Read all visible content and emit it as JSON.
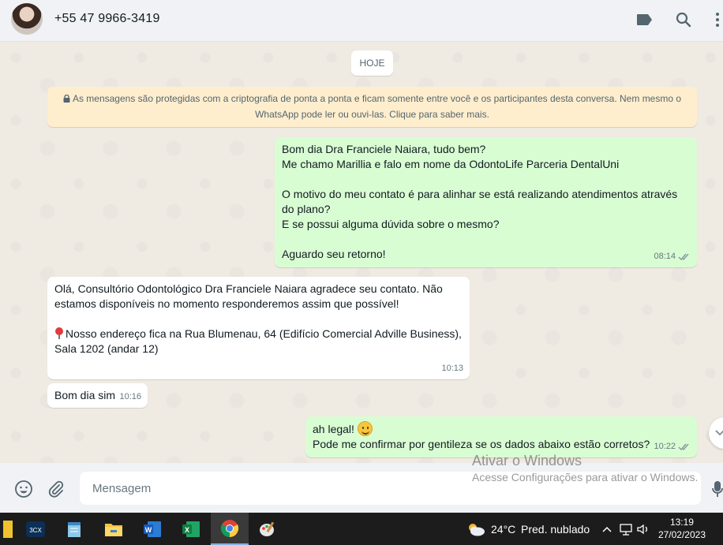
{
  "header": {
    "contact_name": "+55 47 9966-3419",
    "icons": [
      "label-icon",
      "search-icon"
    ]
  },
  "chat": {
    "date_chip": "HOJE",
    "encryption_notice": "As mensagens são protegidas com a criptografia de ponta a ponta e ficam somente entre você e os participantes desta conversa. Nem mesmo o WhatsApp pode ler ou ouvi-las. Clique para saber mais.",
    "messages": [
      {
        "direction": "outgoing",
        "text": "Bom dia Dra Franciele Naiara, tudo bem?\nMe chamo Marillia e falo em nome da OdontoLife Parceria DentalUni\n\nO motivo do meu contato é para alinhar se está realizando atendimentos através do plano?\nE se possui alguma dúvida sobre o mesmo?\n\nAguardo seu retorno!",
        "time": "08:14",
        "status": "read"
      },
      {
        "direction": "incoming",
        "text": "Olá, Consultório Odontológico Dra Franciele Naiara agradece seu contato. Não estamos disponíveis no momento responderemos assim que possível!\n\n",
        "address": "Nosso endereço fica na Rua Blumenau, 64 (Edifício Comercial Adville Business), Sala 1202 (andar 12)",
        "time": "10:13"
      },
      {
        "direction": "incoming",
        "text": "Bom dia sim",
        "time": "10:16"
      },
      {
        "direction": "outgoing",
        "line1": "ah legal!",
        "line2": "Pode me confirmar por gentileza se os dados abaixo estão corretos?",
        "time": "10:22",
        "status": "read"
      }
    ]
  },
  "composer": {
    "placeholder": "Mensagem"
  },
  "watermark": {
    "title": "Ativar o Windows",
    "subtitle": "Acesse Configurações para ativar o Windows."
  },
  "taskbar": {
    "apps": [
      "3CX",
      "notepad",
      "file-explorer",
      "word",
      "excel",
      "chrome",
      "paint"
    ],
    "weather_temp": "24°C",
    "weather_desc": "Pred. nublado",
    "time": "13:19",
    "date": "27/02/2023"
  },
  "colors": {
    "outgoing_bubble": "#d9fdd3",
    "incoming_bubble": "#ffffff",
    "chat_background": "#efeae2",
    "encryption_banner": "#ffeecd",
    "read_ticks": "#53bdeb"
  }
}
